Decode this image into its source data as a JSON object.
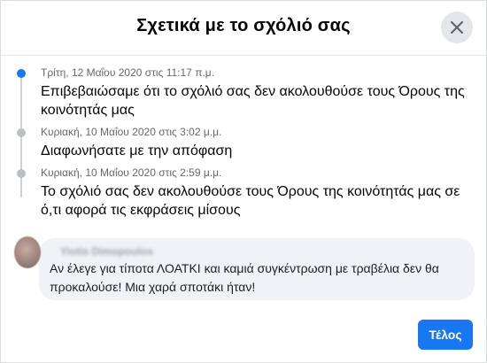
{
  "dialog": {
    "title": "Σχετικά με το σχόλιό σας",
    "close_icon": "close-icon",
    "done_label": "Τέλος"
  },
  "timeline": [
    {
      "date": "Τρίτη, 12 Μαΐου 2020 στις 11:17 π.μ.",
      "text": "Επιβεβαιώσαμε ότι το σχόλιό σας δεν ακολουθούσε τους Όρους της κοινότητάς μας",
      "active": true
    },
    {
      "date": "Κυριακή, 10 Μαΐου 2020 στις 3:02 μ.μ.",
      "text": "Διαφωνήσατε με την απόφαση",
      "active": false
    },
    {
      "date": "Κυριακή, 10 Μαΐου 2020 στις 2:59 μ.μ.",
      "text": "Το σχόλιό σας δεν ακολουθούσε τους Όρους της κοινότητάς μας σε ό,τι αφορά τις εκφράσεις μίσους",
      "active": false
    }
  ],
  "comment": {
    "author": "Yiotis Dimopoulos",
    "text": "Αν έλεγε για τίποτα ΛΟΑΤΚΙ και καμιά συγκέντρωση με τραβέλια δεν θα προκαλούσε! Μια χαρά σποτάκι ήταν!"
  },
  "colors": {
    "accent": "#1877f2",
    "bubble": "#f0f2f5",
    "secondary_text": "#65676b"
  }
}
